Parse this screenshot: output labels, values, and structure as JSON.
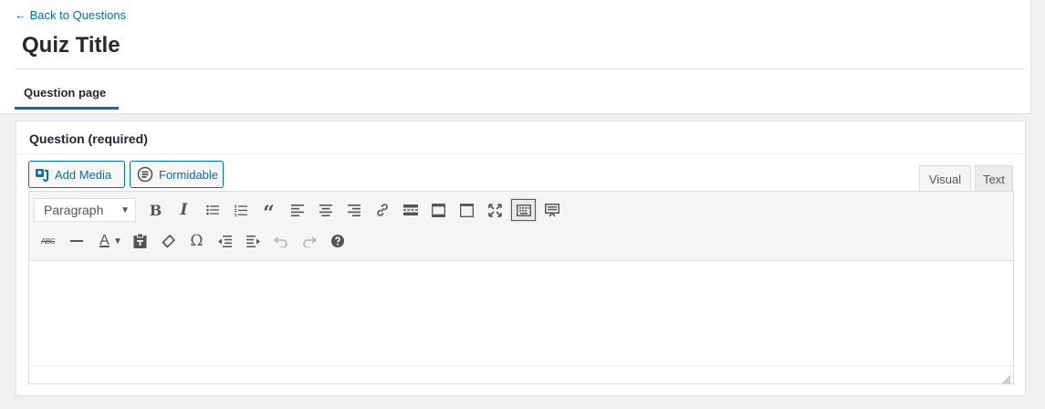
{
  "nav": {
    "back_link": "← Back to Questions"
  },
  "page": {
    "title": "Quiz Title"
  },
  "tabs": [
    {
      "label": "Question page",
      "active": true
    }
  ],
  "postbox": {
    "title": "Question (required)",
    "buttons": {
      "add_media": "Add Media",
      "formidable": "Formidable"
    },
    "modes": {
      "visual": "Visual",
      "text": "Text",
      "active": "visual"
    }
  },
  "editor": {
    "format_select": "Paragraph",
    "toolbar_row1": [
      "bold-icon",
      "italic-icon",
      "bullet-list-icon",
      "numbered-list-icon",
      "blockquote-icon",
      "align-left-icon",
      "align-center-icon",
      "align-right-icon",
      "link-icon",
      "read-more-icon",
      "insert-block-icon",
      "page-break-icon",
      "fullscreen-icon",
      "toolbar-toggle-icon",
      "preview-icon"
    ],
    "toolbar_row2": [
      "strikethrough-icon",
      "horizontal-line-icon",
      "text-color-icon",
      "paste-text-icon",
      "clear-formatting-icon",
      "special-character-icon",
      "outdent-icon",
      "indent-icon",
      "undo-icon",
      "redo-icon",
      "help-icon"
    ],
    "content": ""
  },
  "colors": {
    "accent": "#0073aa",
    "text": "#23282d",
    "background": "#f1f1f1"
  }
}
